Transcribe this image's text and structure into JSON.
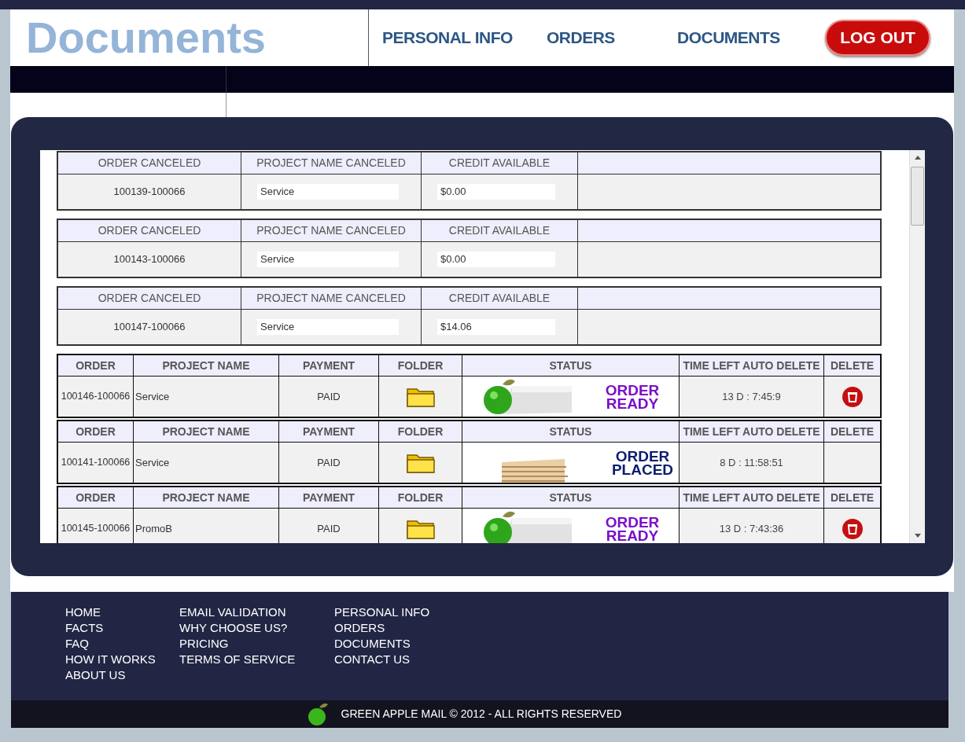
{
  "header": {
    "title": "Documents",
    "nav": [
      "PERSONAL INFO",
      "ORDERS",
      "DOCUMENTS"
    ],
    "logout": "LOG OUT"
  },
  "canceled_orders": [
    {
      "columns": [
        "ORDER CANCELED",
        "PROJECT NAME CANCELED",
        "CREDIT AVAILABLE"
      ],
      "order": "100139-100066",
      "project": "Service",
      "credit": "$0.00"
    },
    {
      "columns": [
        "ORDER CANCELED",
        "PROJECT NAME CANCELED",
        "CREDIT AVAILABLE"
      ],
      "order": "100143-100066",
      "project": "Service",
      "credit": "$0.00"
    },
    {
      "columns": [
        "ORDER CANCELED",
        "PROJECT NAME CANCELED",
        "CREDIT AVAILABLE"
      ],
      "order": "100147-100066",
      "project": "Service",
      "credit": "$14.06"
    }
  ],
  "orders": [
    {
      "columns": [
        "ORDER",
        "PROJECT NAME",
        "PAYMENT",
        "FOLDER",
        "STATUS",
        "TIME LEFT AUTO DELETE",
        "DELETE"
      ],
      "order": "100146-100066",
      "project": "Service",
      "payment": "PAID",
      "status": {
        "kind": "ready",
        "text": "ORDER READY"
      },
      "time_left": "13 D : 7:45:9",
      "deletable": true
    },
    {
      "columns": [
        "ORDER",
        "PROJECT NAME",
        "PAYMENT",
        "FOLDER",
        "STATUS",
        "TIME LEFT AUTO DELETE",
        "DELETE"
      ],
      "order": "100141-100066",
      "project": "Service",
      "payment": "PAID",
      "status": {
        "kind": "placed",
        "text": "ORDER PLACED"
      },
      "time_left": "8 D : 11:58:51",
      "deletable": false
    },
    {
      "columns": [
        "ORDER",
        "PROJECT NAME",
        "PAYMENT",
        "FOLDER",
        "STATUS",
        "TIME LEFT AUTO DELETE",
        "DELETE"
      ],
      "order": "100145-100066",
      "project": "PromoB",
      "payment": "PAID",
      "status": {
        "kind": "ready",
        "text": "ORDER READY"
      },
      "time_left": "13 D : 7:43:36",
      "deletable": true
    }
  ],
  "footer": {
    "columns": [
      [
        "HOME",
        "FACTS",
        "FAQ",
        "HOW IT WORKS",
        "ABOUT US"
      ],
      [
        "EMAIL VALIDATION",
        "WHY CHOOSE US?",
        "PRICING",
        "TERMS OF SERVICE"
      ],
      [
        "PERSONAL INFO",
        "ORDERS",
        "DOCUMENTS",
        "CONTACT US"
      ]
    ],
    "copyright": "GREEN APPLE MAIL © 2012 - ALL RIGHTS RESERVED"
  }
}
